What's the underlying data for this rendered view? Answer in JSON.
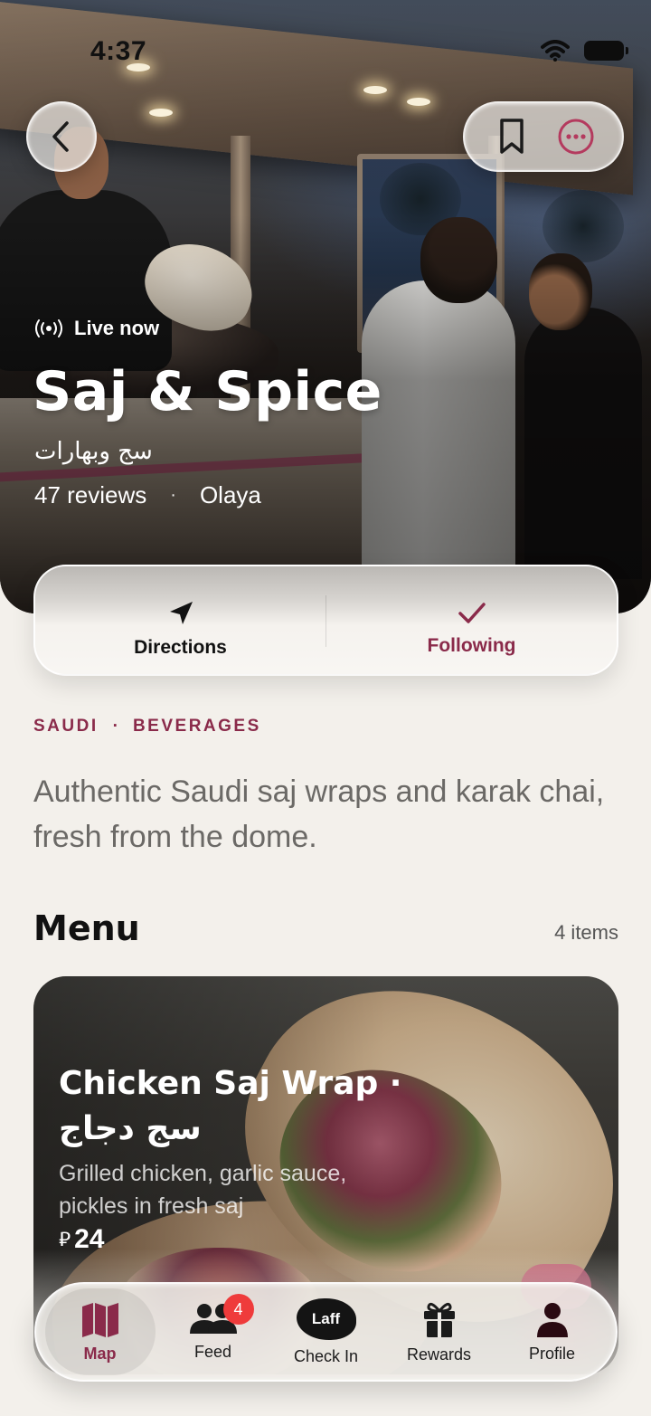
{
  "status_bar": {
    "time": "4:37"
  },
  "header": {
    "back_icon": "chevron-left-icon",
    "bookmark_icon": "bookmark-icon",
    "more_icon": "ellipsis-circle-icon"
  },
  "vendor": {
    "live_label": "Live now",
    "name": "Saj & Spice",
    "name_arabic": "سج وبهارات",
    "reviews": "47 reviews",
    "separator": "·",
    "location": "Olaya"
  },
  "actions": {
    "directions_label": "Directions",
    "following_label": "Following"
  },
  "tags": [
    "SAUDI",
    "BEVERAGES"
  ],
  "tag_separator": "·",
  "description": "Authentic Saudi saj wraps and karak chai, fresh from the dome.",
  "menu": {
    "title": "Menu",
    "count_label": "4 items",
    "items": [
      {
        "name": "Chicken Saj Wrap ·",
        "name_arabic": "سج دجاج",
        "description": "Grilled chicken, garlic sauce, pickles in fresh saj",
        "currency": "⃁",
        "price": "24"
      }
    ]
  },
  "tabbar": {
    "tabs": [
      {
        "label": "Map",
        "icon": "map-icon",
        "active": true
      },
      {
        "label": "Feed",
        "icon": "people-icon",
        "badge": "4"
      },
      {
        "label": "Check In",
        "icon": "laff-logo",
        "logo_text": "Laff"
      },
      {
        "label": "Rewards",
        "icon": "gift-icon"
      },
      {
        "label": "Profile",
        "icon": "person-icon"
      }
    ]
  },
  "colors": {
    "accent": "#8a2a4a",
    "badge": "#ef3b3b",
    "background": "#f3f0eb"
  }
}
